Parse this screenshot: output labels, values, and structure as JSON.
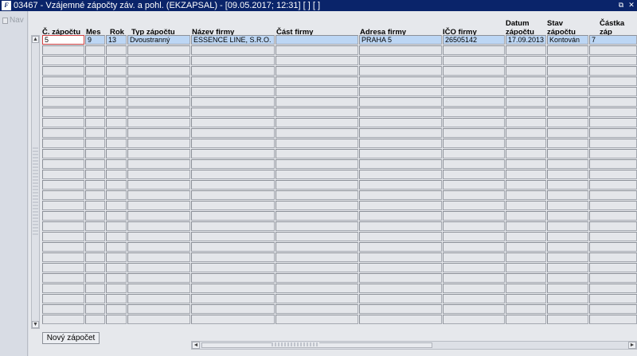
{
  "window": {
    "title": "03467 - Vzájemné zápočty záv. a pohl. (EKZAPSAL) - [09.05.2017; 12:31] [ ] [ ]",
    "icon_name": "app-logo-icon",
    "restore_glyph": "⧉",
    "close_glyph": "✕"
  },
  "nav": {
    "label": "Nav"
  },
  "columns": [
    {
      "label": "Č. zápočtu",
      "label2": ""
    },
    {
      "label": "Mes",
      "label2": ""
    },
    {
      "label": "Rok",
      "label2": ""
    },
    {
      "label": "Typ zápočtu",
      "label2": ""
    },
    {
      "label": "Název firmy",
      "label2": ""
    },
    {
      "label": "Část firmy",
      "label2": ""
    },
    {
      "label": "Adresa firmy",
      "label2": ""
    },
    {
      "label": "IČO firmy",
      "label2": ""
    },
    {
      "label": "Datum",
      "label2": "zápočtu"
    },
    {
      "label": "Stav",
      "label2": "zápočtu"
    },
    {
      "label": "Částka záp",
      "label2": ""
    }
  ],
  "rows": [
    [
      "5",
      "9",
      "13",
      "Dvoustranný",
      "ESSENCE LINE, S.R.O.",
      "",
      "PRAHA  5",
      "26505142",
      "17.09.2013",
      "Kontován",
      "7"
    ]
  ],
  "empty_row_count": 27,
  "buttons": {
    "new_offset": "Nový zápočet"
  },
  "scroll": {
    "up": "▲",
    "down": "▼",
    "left": "◄",
    "right": "►"
  },
  "colors": {
    "titlebar": "#0a246a",
    "selected_row": "#bcd6f4",
    "focus_border": "#d04040"
  }
}
